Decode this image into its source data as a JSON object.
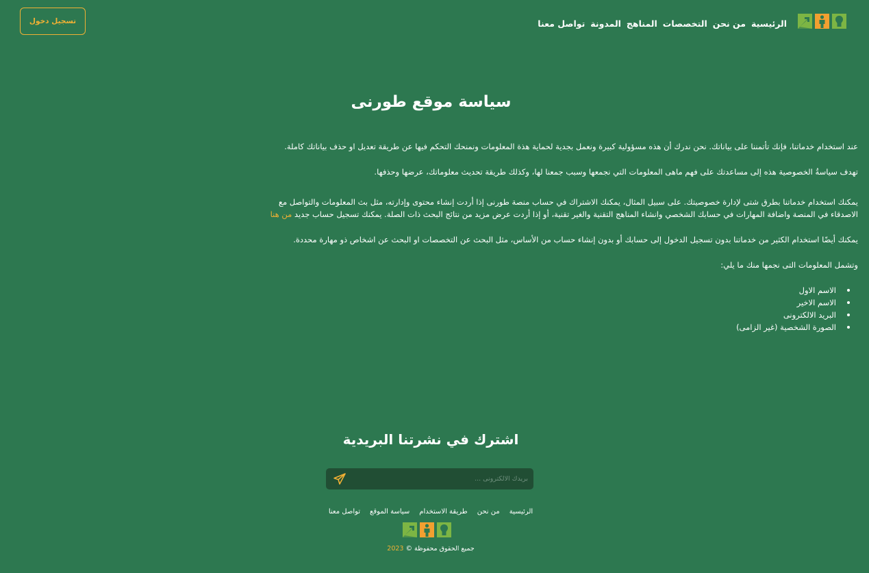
{
  "colors": {
    "background": "#2d7850",
    "accent": "#f2b134",
    "logo_green": "#7db544",
    "logo_orange": "#f2a030",
    "input_background": "#214e34"
  },
  "header": {
    "logo_icons": [
      "bulb-tile-icon",
      "person-tile-icon",
      "arrow-tile-icon"
    ],
    "nav": [
      {
        "label": "الرئيسية"
      },
      {
        "label": "من نحن"
      },
      {
        "label": "التخصصات"
      },
      {
        "label": "المناهج"
      },
      {
        "label": "المدونة"
      },
      {
        "label": "تواصل معنا"
      }
    ],
    "login_label": "تسجيل دخول"
  },
  "main": {
    "title": "سياسة موقع طورنى",
    "paragraphs": [
      "عند استخدام خدماتنا، فإنك تأتمننا على بياناتك. نحن ندرك أن هذه مسؤولية كبيرة ونعمل بجدية لحماية هذة المعلومات ونمنحك التحكم فيها عن طريقة تعديل او حذف بياناتك كاملة.",
      "تهدف سياسةُ الخصوصية هذه إلى مساعدتك على فهم ماهى المعلومات التي نجمعها وسبب جمعنا لها، وكذلك طريقة تحديث معلوماتك، عرضها وحذفها."
    ],
    "paragraph3": "يمكنك استخدام خدماتنا بطرق شتى لإدارة خصوصيتك. على سبيل المثال، يمكنك الاشتراك في حساب منصة طورنى إذا أردت إنشاء محتوى وإدارته، مثل بث المعلومات والتواصل مع الاصدقاء في المنصة واضافة المهارات في حسابك الشخصي وانشاء المناهج التقنية والغير تقنية، أو إذا أردت عرض مزيد من نتائج البحث ذات الصلة. يمكنك تسجيل حساب جديد",
    "register_link": "من هنا",
    "paragraph4": "يمكنك أيضًا استخدام الكثير من خدماتنا بدون تسجيل الدخول إلى حسابك أو بدون إنشاء حساب من الأساس، مثل البحث عن التخصصات او البحث عن اشخاص ذو مهارة محددة.",
    "list_intro": "وتشمل المعلومات التى نجمها منك ما يلي:",
    "collected_data": [
      "الاسم الاول",
      "الاسم الاخير",
      "البريد الالكترونى",
      "الصورة الشخصية (غير الزامى)"
    ]
  },
  "newsletter": {
    "title": "اشترك في نشرتنا البريدية",
    "placeholder": "بريدك الالكترونى ...",
    "send_icon": "send-icon"
  },
  "footer": {
    "links": [
      {
        "label": "الرئيسية"
      },
      {
        "label": "من نحن"
      },
      {
        "label": "طريقة الاستخدام"
      },
      {
        "label": "سياسة الموقع"
      },
      {
        "label": "تواصل معنا"
      }
    ],
    "copyright_text": "جميع الحقوق محفوظة ©",
    "copyright_year": "2023"
  }
}
